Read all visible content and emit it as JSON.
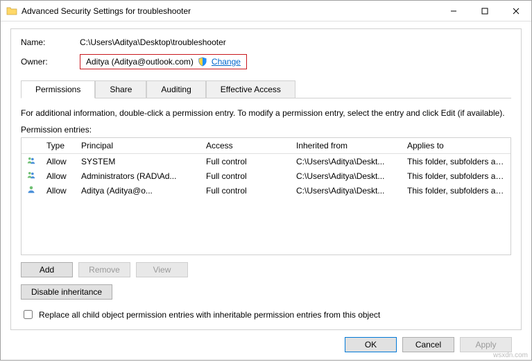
{
  "window": {
    "title": "Advanced Security Settings for troubleshooter"
  },
  "header": {
    "name_label": "Name:",
    "name_value": "C:\\Users\\Aditya\\Desktop\\troubleshooter",
    "owner_label": "Owner:",
    "owner_value": "Aditya (Aditya@outlook.com)",
    "change_link": "Change"
  },
  "tabs": {
    "permissions": "Permissions",
    "share": "Share",
    "auditing": "Auditing",
    "effective": "Effective Access"
  },
  "info_text": "For additional information, double-click a permission entry. To modify a permission entry, select the entry and click Edit (if available).",
  "entries_label": "Permission entries:",
  "columns": {
    "type": "Type",
    "principal": "Principal",
    "access": "Access",
    "inherited": "Inherited from",
    "applies": "Applies to"
  },
  "rows": [
    {
      "type": "Allow",
      "principal": "SYSTEM",
      "access": "Full control",
      "inherited": "C:\\Users\\Aditya\\Deskt...",
      "applies": "This folder, subfolders and files"
    },
    {
      "type": "Allow",
      "principal": "Administrators (RAD\\Ad...",
      "access": "Full control",
      "inherited": "C:\\Users\\Aditya\\Deskt...",
      "applies": "This folder, subfolders and files"
    },
    {
      "type": "Allow",
      "principal": "Aditya (Aditya@o...",
      "access": "Full control",
      "inherited": "C:\\Users\\Aditya\\Deskt...",
      "applies": "This folder, subfolders and files"
    }
  ],
  "buttons": {
    "add": "Add",
    "remove": "Remove",
    "view": "View",
    "disable_inh": "Disable inheritance",
    "ok": "OK",
    "cancel": "Cancel",
    "apply": "Apply"
  },
  "checkbox_label": "Replace all child object permission entries with inheritable permission entries from this object",
  "watermark": "wsxdn.com"
}
